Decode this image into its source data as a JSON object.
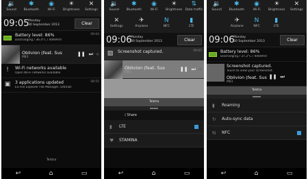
{
  "panel1": {
    "quick": [
      {
        "icon": "sound-icon",
        "glyph": "🔉",
        "label": "Sound"
      },
      {
        "icon": "bluetooth-icon",
        "glyph": "✱",
        "label": "Bluetooth"
      },
      {
        "icon": "wifi-icon",
        "glyph": "◉",
        "label": "Wi-Fi"
      },
      {
        "icon": "brightness-icon",
        "glyph": "☀",
        "label": "Brightness"
      },
      {
        "icon": "settings-icon",
        "glyph": "✕",
        "label": "Settings"
      }
    ],
    "time": "09:05",
    "day": "Monday",
    "date": "30 September 2013",
    "clear": "Clear",
    "battery": {
      "title": "Battery level: 86%",
      "sub": "Discharging / 36.4°C / 4069mV",
      "time": "09:04"
    },
    "media": {
      "title": "Oblivion (feat. Sus",
      "sub": "M83"
    },
    "wifi": {
      "title": "Wi-Fi networks available",
      "sub": "Open Wi-Fi networks available"
    },
    "apps": {
      "title": "3 applications updated",
      "sub": "ES File Explorer  File Manager, Ultimat",
      "time": "08:55"
    },
    "operator": "Telstra"
  },
  "panel2": {
    "quick1": [
      {
        "icon": "sound-icon",
        "glyph": "🔉",
        "label": "Sound"
      },
      {
        "icon": "bluetooth-icon",
        "glyph": "✱",
        "label": "Bluetooth"
      },
      {
        "icon": "wifi-icon",
        "glyph": "◉",
        "label": "Wi-Fi"
      },
      {
        "icon": "brightness-icon",
        "glyph": "☀",
        "label": "Brightness"
      },
      {
        "icon": "data-icon",
        "glyph": "⇅",
        "label": "Data traffic"
      }
    ],
    "quick2": [
      {
        "icon": "settings-icon",
        "glyph": "✕",
        "label": "Settings"
      },
      {
        "icon": "airplane-icon",
        "glyph": "✈",
        "label": "Airplane"
      },
      {
        "icon": "nfc-icon",
        "glyph": "N",
        "label": "NFC"
      },
      {
        "icon": "lte-icon",
        "glyph": "▮",
        "label": "LTE"
      }
    ],
    "time": "09:06",
    "day": "Monday",
    "date": "30 September 2013",
    "clear": "Clear",
    "screenshot": {
      "title": "Screenshot captured.",
      "time": "09:05"
    },
    "media": {
      "title": "Oblivion (feat. Sus",
      "sub": "M83"
    },
    "operator": "Telstra",
    "share": "Share",
    "lte": "LTE",
    "stamina": "STAMINA"
  },
  "panel3": {
    "quick": [
      {
        "icon": "sound-icon",
        "glyph": "🔉",
        "label": "Sound"
      },
      {
        "icon": "bluetooth-icon",
        "glyph": "✱",
        "label": "Bluetooth"
      },
      {
        "icon": "wifi-icon",
        "glyph": "◉",
        "label": "Wi-Fi"
      },
      {
        "icon": "brightness-icon",
        "glyph": "☀",
        "label": "Brightness"
      },
      {
        "icon": "settings-icon",
        "glyph": "✕",
        "label": "Settings"
      }
    ],
    "quick2": [
      {
        "icon": "airplane-icon",
        "glyph": "✈",
        "label": "Airplane"
      },
      {
        "icon": "nfc-icon",
        "glyph": "N",
        "label": "NFC"
      },
      {
        "icon": "lte-icon",
        "glyph": "▮",
        "label": "LTE"
      }
    ],
    "time": "09:06",
    "day": "Monday",
    "date": "30 September 2013",
    "clear": "Clear",
    "battery": {
      "title": "Battery level: 86%",
      "sub": "Discharging / 37.2°C / 4069mV"
    },
    "screenshot": {
      "title": "Screenshot captured.",
      "sub": "Touch to view your screenshot."
    },
    "media": {
      "title": "Oblivion (feat. Sus",
      "sub": "M83"
    },
    "operator": "Telstra",
    "roaming": "Roaming",
    "autosync": "Auto-sync data",
    "nfc": "NFC"
  }
}
